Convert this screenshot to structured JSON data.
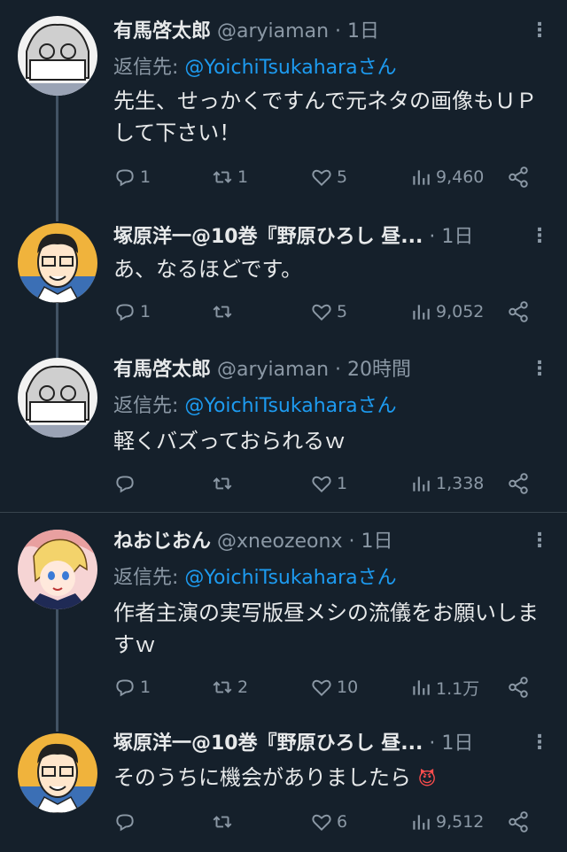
{
  "tweets": [
    {
      "name": "有馬啓太郎",
      "handle": "@aryiaman",
      "time": "1日",
      "reply_label": "返信先:",
      "reply_mention": "@YoichiTsukahara",
      "reply_suffix": "さん",
      "text": "先生、せっかくですんで元ネタの画像もＵＰして下さい！",
      "replies": "1",
      "retweets": "1",
      "likes": "5",
      "views": "9,460",
      "avatar": "manga-masked-avatar"
    },
    {
      "name": "塚原洋一@10巻『野原ひろし 昼...",
      "handle": "",
      "time": "1日",
      "text": "あ、なるほどです。",
      "replies": "1",
      "retweets": "",
      "likes": "5",
      "views": "9,052",
      "avatar": "manga-glasses-avatar"
    },
    {
      "name": "有馬啓太郎",
      "handle": "@aryiaman",
      "time": "20時間",
      "reply_label": "返信先:",
      "reply_mention": "@YoichiTsukahara",
      "reply_suffix": "さん",
      "text": "軽くバズっておられるｗ",
      "replies": "",
      "retweets": "",
      "likes": "1",
      "views": "1,338",
      "avatar": "manga-masked-avatar"
    },
    {
      "name": "ねおじおん",
      "handle": "@xneozeonx",
      "time": "1日",
      "reply_label": "返信先:",
      "reply_mention": "@YoichiTsukahara",
      "reply_suffix": "さん",
      "text": "作者主演の実写版昼メシの流儀をお願いしますｗ",
      "replies": "1",
      "retweets": "2",
      "likes": "10",
      "views": "1.1万",
      "avatar": "anime-character-avatar"
    },
    {
      "name": "塚原洋一@10巻『野原ひろし 昼...",
      "handle": "",
      "time": "1日",
      "text": "そのうちに機会がありましたら",
      "emoji": "😈",
      "replies": "",
      "retweets": "",
      "likes": "6",
      "views": "9,512",
      "avatar": "manga-glasses-avatar"
    }
  ],
  "dot": "·",
  "more": "⋮",
  "colors": {
    "background": "#15202b",
    "text": "#e7e9ea",
    "muted": "#8b98a5",
    "accent": "#1d9bf0"
  }
}
